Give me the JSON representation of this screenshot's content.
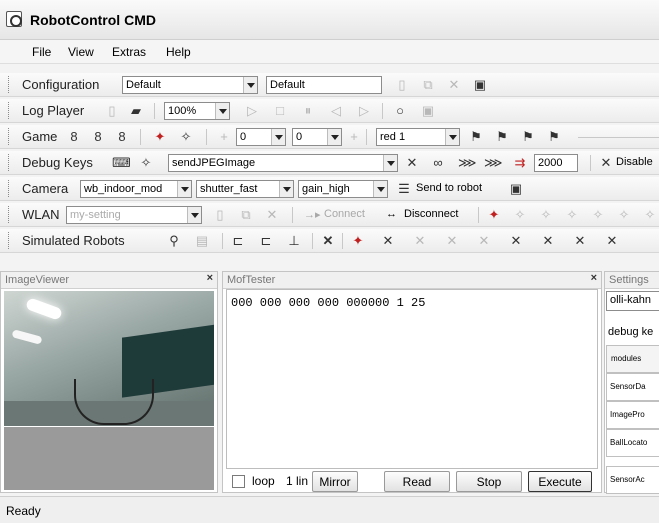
{
  "window": {
    "title": "RobotControl CMD"
  },
  "menu": {
    "file": "File",
    "view": "View",
    "extras": "Extras",
    "help": "Help"
  },
  "configuration": {
    "label": "Configuration",
    "combo_value": "Default",
    "text_value": "Default"
  },
  "log_player": {
    "label": "Log Player",
    "zoom_value": "100%"
  },
  "game": {
    "label": "Game",
    "field1_value": "0",
    "field2_value": "0",
    "team_value": "red 1"
  },
  "debug_keys": {
    "label": "Debug Keys",
    "command_value": "sendJPEGImage",
    "interval_value": "2000",
    "disable_label": "Disable"
  },
  "camera": {
    "label": "Camera",
    "setting_value": "wb_indoor_mod",
    "shutter_value": "shutter_fast",
    "gain_value": "gain_high",
    "send_label": "Send to robot"
  },
  "wlan": {
    "label": "WLAN",
    "setting_placeholder": "my-setting",
    "connect_label": "Connect",
    "disconnect_label": "Disconnect"
  },
  "simulated_robots": {
    "label": "Simulated Robots"
  },
  "image_viewer": {
    "title": "ImageViewer"
  },
  "mof_tester": {
    "title": "MofTester",
    "editor_text": "000 000 000 000 000000 1 25",
    "loop_label": "loop",
    "lines_label": "1 lin",
    "mirror_label": "Mirror",
    "read_label": "Read",
    "stop_label": "Stop",
    "execute_label": "Execute"
  },
  "settings": {
    "title": "Settings",
    "value": "olli-kahn",
    "debug_keys_label": "debug ke",
    "modules_header": "modules",
    "modules": [
      "SensorDa",
      "ImagePro",
      "BallLocato",
      "SensorAc"
    ]
  },
  "status": {
    "text": "Ready"
  },
  "icons": [
    "app-icon",
    "new-file-icon",
    "copy-icon",
    "delete-icon",
    "save-icon",
    "open-folder-icon",
    "play-icon",
    "stop-icon",
    "pause-icon",
    "step-back-icon",
    "step-forward-icon",
    "record-icon",
    "flag-icon",
    "plus-icon",
    "robot-icon",
    "infinity-icon",
    "send-icon",
    "connect-icon",
    "disconnect-icon",
    "search-icon",
    "close-icon"
  ]
}
